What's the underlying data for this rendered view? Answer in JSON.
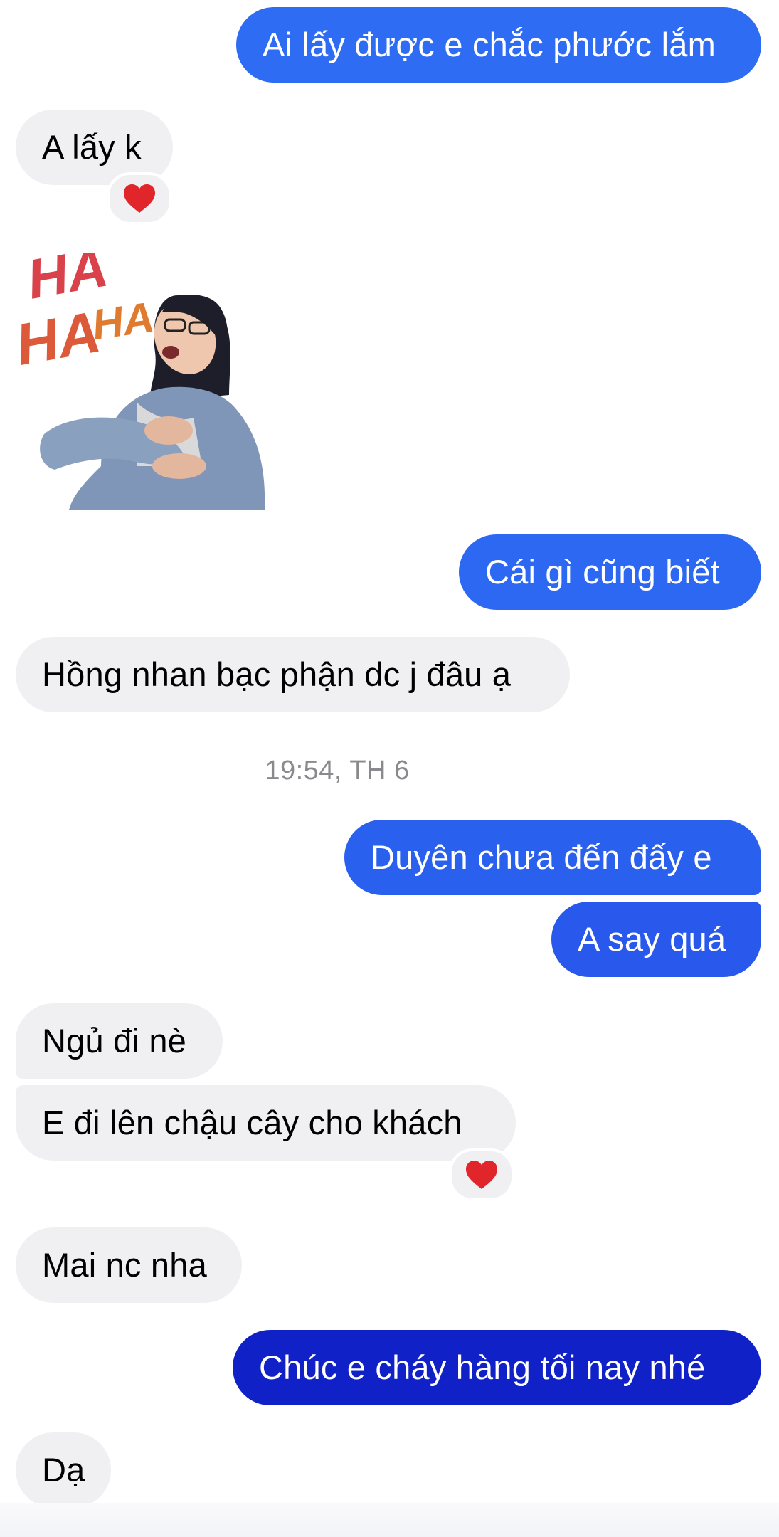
{
  "colors": {
    "outgoing_top": "#2f6df4",
    "outgoing_bottom": "#1121c8",
    "incoming_bg": "#f0f0f3",
    "heart": "#e0252b"
  },
  "messages": [
    {
      "from": "me",
      "text": "Ai lấy được e chắc phước lắm"
    },
    {
      "from": "them",
      "text": "A lấy k",
      "reaction": "heart-icon"
    },
    {
      "from": "them",
      "sticker": "haha-laughing-sticker",
      "sticker_text": [
        "HA",
        "HA",
        "HA"
      ]
    },
    {
      "from": "me",
      "text": "Cái gì cũng biết"
    },
    {
      "from": "them",
      "text": "Hồng nhan bạc phận dc j đâu ạ"
    },
    {
      "from": "me",
      "text": "Duyên chưa đến đấy e"
    },
    {
      "from": "me",
      "text": "A say quá"
    },
    {
      "from": "them",
      "text": "Ngủ đi nè"
    },
    {
      "from": "them",
      "text": "E đi lên chậu cây cho khách",
      "reaction": "heart-icon"
    },
    {
      "from": "them",
      "text": "Mai nc nha"
    },
    {
      "from": "me",
      "text": "Chúc e cháy hàng tối nay nhé"
    },
    {
      "from": "them",
      "text": "Dạ"
    }
  ],
  "timestamp": "19:54, TH 6"
}
